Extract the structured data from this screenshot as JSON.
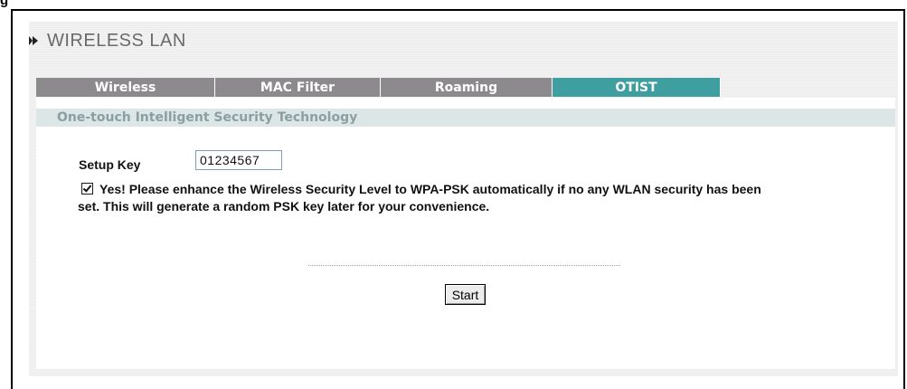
{
  "figure_label": "g",
  "header": {
    "title": "WIRELESS LAN",
    "icon": "bullet-arrow-icon"
  },
  "tabs": [
    {
      "label": "Wireless",
      "active": false
    },
    {
      "label": "MAC Filter",
      "active": false
    },
    {
      "label": "Roaming",
      "active": false
    },
    {
      "label": "OTIST",
      "active": true
    }
  ],
  "section": {
    "title": "One-touch Intelligent Security Technology"
  },
  "setup_key": {
    "label": "Setup Key",
    "value": "01234567"
  },
  "auto_security": {
    "checked": true,
    "text_line1": "Yes! Please enhance the Wireless Security Level to WPA-PSK automatically if no any WLAN security has been",
    "text_line2": "set. This will generate a random PSK key later for your convenience."
  },
  "actions": {
    "start_label": "Start"
  },
  "colors": {
    "tab_inactive": "#8c8a8c",
    "tab_active": "#3f9fa0",
    "section_bar": "#dde6e7",
    "section_text": "#8a9fa1"
  }
}
